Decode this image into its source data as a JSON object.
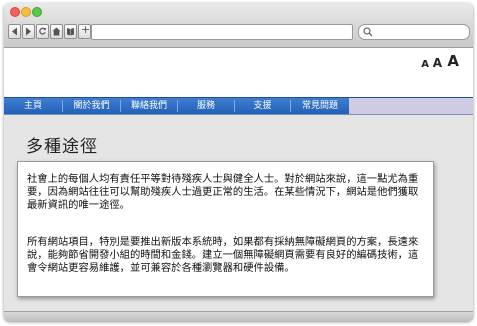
{
  "browser": {
    "new_tab_symbol": "+"
  },
  "font_size_controls": [
    "A",
    "A",
    "A"
  ],
  "nav": {
    "items": [
      "主頁",
      "關於我們",
      "聯絡我們",
      "服務",
      "支援",
      "常見問題"
    ]
  },
  "main": {
    "heading": "多種途徑",
    "paragraphs": [
      "社會上的每個人均有責任平等對待殘疾人士與健全人士。對於網站來說，這一點尤為重要，因為網站往往可以幫助殘疾人士過更正常的生活。在某些情況下，網站是他們獲取最新資訊的唯一途徑。",
      "所有網站項目，特別是要推出新版本系統時，如果都有採納無障礙網頁的方案，長遠來說，能夠節省開發小組的時間和金錢。建立一個無障礙網頁需要有良好的編碼技術，這會令網站更容易維護，並可兼容於各種瀏覽器和硬件設備。"
    ]
  },
  "colors": {
    "nav_blue": "#2a6bc2",
    "nav_tail": "#cfcbe2",
    "content_bg": "#e5e5e5"
  }
}
